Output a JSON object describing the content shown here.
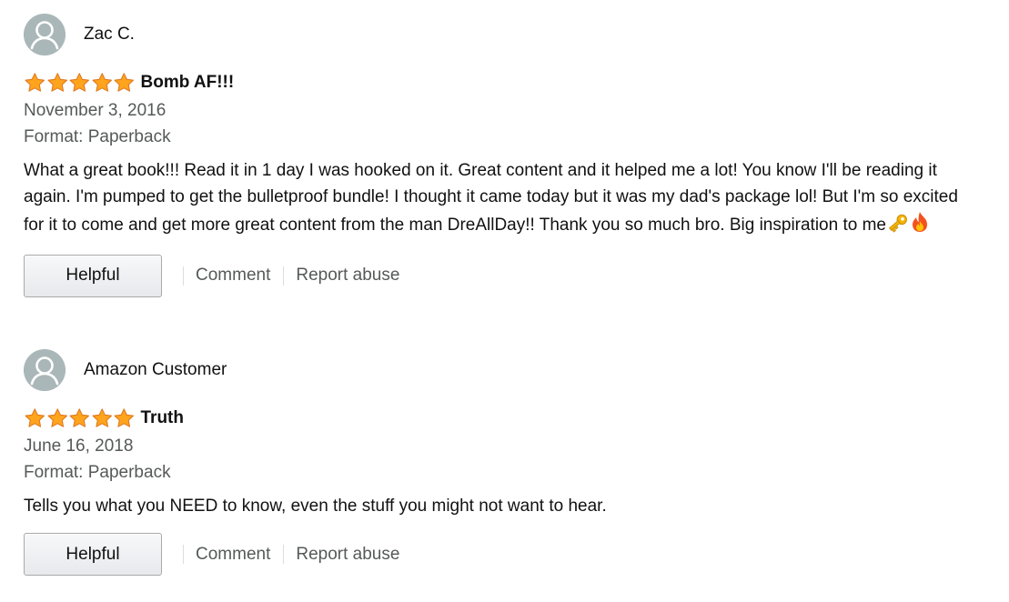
{
  "reviews": [
    {
      "profile_name": "Zac C.",
      "rating": 5,
      "title": "Bomb AF!!!",
      "date": "November 3, 2016",
      "format": "Format: Paperback",
      "body": "What a great book!!! Read it in 1 day I was hooked on it. Great content and it helped me a lot! You know I'll be reading it again. I'm pumped to get the bulletproof bundle! I thought it came today but it was my dad's package lol! But I'm so excited for it to come and get more great content from the man DreAllDay!! Thank you so much bro. Big inspiration to me",
      "emojis": [
        "key-emoji",
        "fire-emoji"
      ]
    },
    {
      "profile_name": "Amazon Customer",
      "rating": 5,
      "title": "Truth",
      "date": "June 16, 2018",
      "format": "Format: Paperback",
      "body": "Tells you what you NEED to know, even the stuff you might not want to hear.",
      "emojis": []
    }
  ],
  "actions": {
    "helpful_label": "Helpful",
    "comment_label": "Comment",
    "report_label": "Report abuse"
  },
  "colors": {
    "star_fill": "#ffa41c",
    "star_stroke": "#de7921",
    "muted_text": "#565959",
    "avatar_bg": "#aab7b8"
  }
}
